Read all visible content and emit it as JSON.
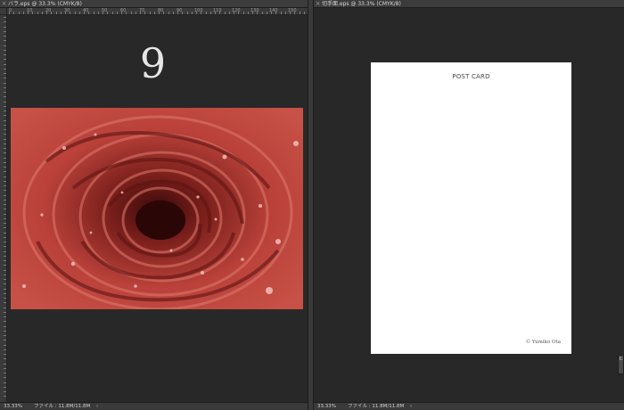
{
  "left_document": {
    "tab_close": "×",
    "tab_title": "バラ.eps @ 33.3% (CMYK/8)",
    "ruler_labels": [
      "0",
      "10",
      "20",
      "30",
      "40",
      "50",
      "60",
      "70",
      "80",
      "90",
      "100",
      "110",
      "120",
      "130",
      "140",
      "150"
    ],
    "big_number": "9",
    "image_subject": "red rose with water droplets",
    "status": {
      "zoom": "33.33%",
      "file_info": "ファイル : 11.8M/11.8M",
      "arrow": "›"
    }
  },
  "right_document": {
    "tab_close": "×",
    "tab_title": "切手面.eps @ 33.3% (CMYK/8)",
    "card_title": "POST CARD",
    "card_credit": "© Yumiko Ota",
    "status": {
      "zoom": "33.33%",
      "file_info": "ファイル : 11.8M/11.8M",
      "arrow": "›"
    }
  },
  "panel_tab": "ヒ",
  "colors": {
    "rose_red": "#b23a31",
    "app_bg": "#282828",
    "chrome": "#3a3a3a"
  }
}
